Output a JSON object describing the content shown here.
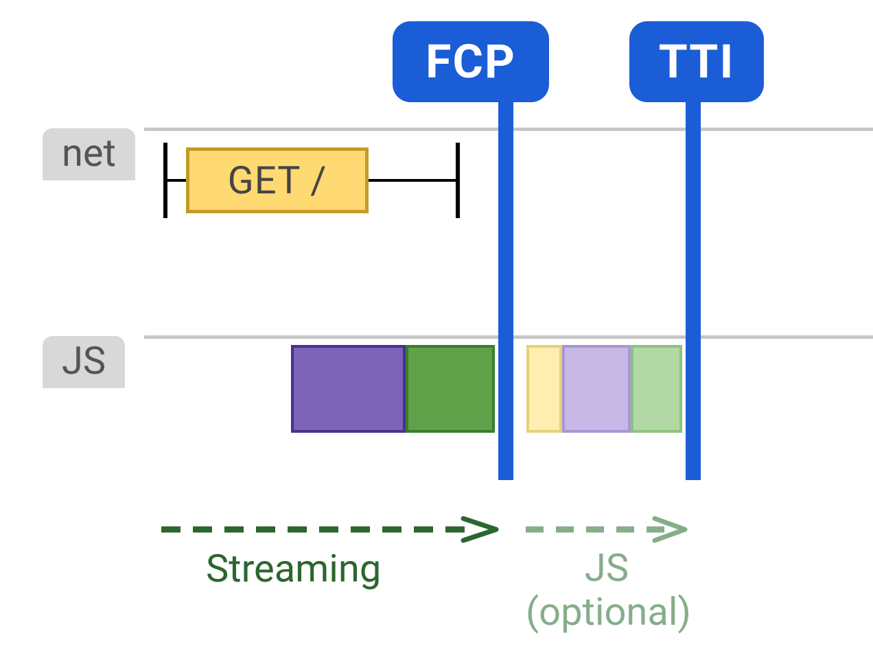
{
  "rows": {
    "net_label": "net",
    "js_label": "JS"
  },
  "net": {
    "request_label": "GET /"
  },
  "milestones": {
    "fcp": "FCP",
    "tti": "TTI"
  },
  "annotations": {
    "streaming": "Streaming",
    "js_line": "JS",
    "optional_line": "(optional)"
  },
  "colors": {
    "pill_blue": "#1b5dd6",
    "get_fill": "#ffd971",
    "get_border": "#c49b27",
    "purple": "#7c65b8",
    "green": "#60a24a",
    "yellow_light": "#ffeeb0",
    "purple_light": "#c6b9e6",
    "green_light": "#b2d9a3",
    "streaming_text": "#2b662e",
    "optional_text": "#86ad8a"
  },
  "chart_data": {
    "type": "timeline",
    "x_range": [
      0,
      100
    ],
    "tracks": [
      {
        "name": "net",
        "items": [
          {
            "kind": "request",
            "label": "GET /",
            "start": 18,
            "box_end": 42,
            "end": 52
          }
        ]
      },
      {
        "name": "JS",
        "items": [
          {
            "kind": "task",
            "color": "purple",
            "start": 33,
            "end": 46,
            "faded": false
          },
          {
            "kind": "task",
            "color": "green",
            "start": 46,
            "end": 56,
            "faded": false
          },
          {
            "kind": "task",
            "color": "yellow",
            "start": 60,
            "end": 64,
            "faded": true
          },
          {
            "kind": "task",
            "color": "purple",
            "start": 64,
            "end": 72,
            "faded": true
          },
          {
            "kind": "task",
            "color": "green",
            "start": 72,
            "end": 78,
            "faded": true
          }
        ]
      }
    ],
    "milestones": [
      {
        "name": "FCP",
        "x": 57
      },
      {
        "name": "TTI",
        "x": 79
      }
    ],
    "annotations": [
      {
        "text": "Streaming",
        "x_start": 18,
        "x_end": 56,
        "style": "solid-dark-green"
      },
      {
        "text": "JS (optional)",
        "x_start": 60,
        "x_end": 78,
        "style": "faded-green"
      }
    ]
  }
}
